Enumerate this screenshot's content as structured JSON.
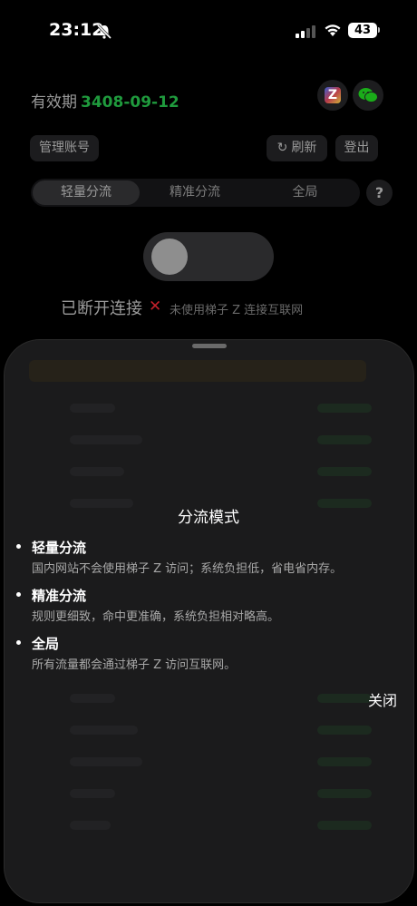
{
  "status_bar": {
    "time": "23:12",
    "battery": "43",
    "icons": [
      "bell-slash-icon",
      "cellular-signal-icon",
      "wifi-icon",
      "battery-icon"
    ]
  },
  "account": {
    "validity_label": "有效期",
    "validity_date": "3408-09-12",
    "date_color": "#1f9a3d"
  },
  "actions": {
    "manage": "管理账号",
    "refresh": "刷新",
    "logout": "登出"
  },
  "modes": {
    "tabs": [
      "轻量分流",
      "精准分流",
      "全局"
    ],
    "selected": "轻量分流",
    "help": "?"
  },
  "connection": {
    "status": "已断开连接",
    "note": "未使用梯子 Z 连接互联网",
    "toggle_on": false
  },
  "modal": {
    "title": "分流模式",
    "items": [
      {
        "head": "轻量分流",
        "desc": "国内网站不会使用梯子 Z 访问；系统负担低，省电省内存。"
      },
      {
        "head": "精准分流",
        "desc": "规则更细致，命中更准确，系统负担相对略高。"
      },
      {
        "head": "全局",
        "desc": "所有流量都会通过梯子 Z 访问互联网。"
      }
    ],
    "close": "关闭"
  }
}
